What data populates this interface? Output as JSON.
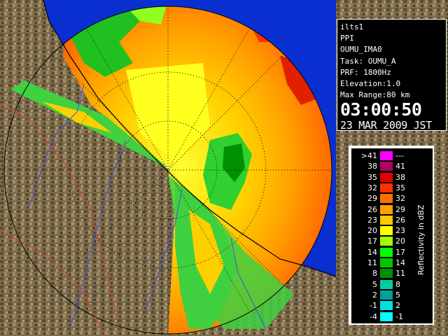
{
  "info": {
    "station": "ilts1",
    "product": "PPI",
    "site": "OUMU_IMA0",
    "task": "Task: OUMU_A",
    "prf": "PRF: 1800Hz",
    "elevation": "Elevation:1.0",
    "max_range": "Max Range:80 km",
    "time": "03:00:50",
    "date": "23 MAR 2009 JST"
  },
  "legend": {
    "unit": "Reflectivity in dBZ",
    "rows": [
      {
        "lo": ">41",
        "hi": "---",
        "color": "#ff00ff"
      },
      {
        "lo": "38",
        "hi": "41",
        "color": "#b00060"
      },
      {
        "lo": "35",
        "hi": "38",
        "color": "#e00000"
      },
      {
        "lo": "32",
        "hi": "35",
        "color": "#ff3000"
      },
      {
        "lo": "29",
        "hi": "32",
        "color": "#ff7000"
      },
      {
        "lo": "26",
        "hi": "29",
        "color": "#ffa000"
      },
      {
        "lo": "23",
        "hi": "26",
        "color": "#ffc800"
      },
      {
        "lo": "20",
        "hi": "23",
        "color": "#ffff00"
      },
      {
        "lo": "17",
        "hi": "20",
        "color": "#a0ff00"
      },
      {
        "lo": "14",
        "hi": "17",
        "color": "#00ff00"
      },
      {
        "lo": "11",
        "hi": "14",
        "color": "#00c800"
      },
      {
        "lo": "8",
        "hi": "11",
        "color": "#009000"
      },
      {
        "lo": "5",
        "hi": "8",
        "color": "#00d0a0"
      },
      {
        "lo": "2",
        "hi": "5",
        "color": "#00a0a0"
      },
      {
        "lo": "-1",
        "hi": "2",
        "color": "#00e0e0"
      },
      {
        "lo": "-4",
        "hi": "-1",
        "color": "#00ffff"
      }
    ]
  },
  "colors": {
    "sea": "#0a2fd0",
    "land": "#7a6a4a",
    "background": "#000000"
  }
}
